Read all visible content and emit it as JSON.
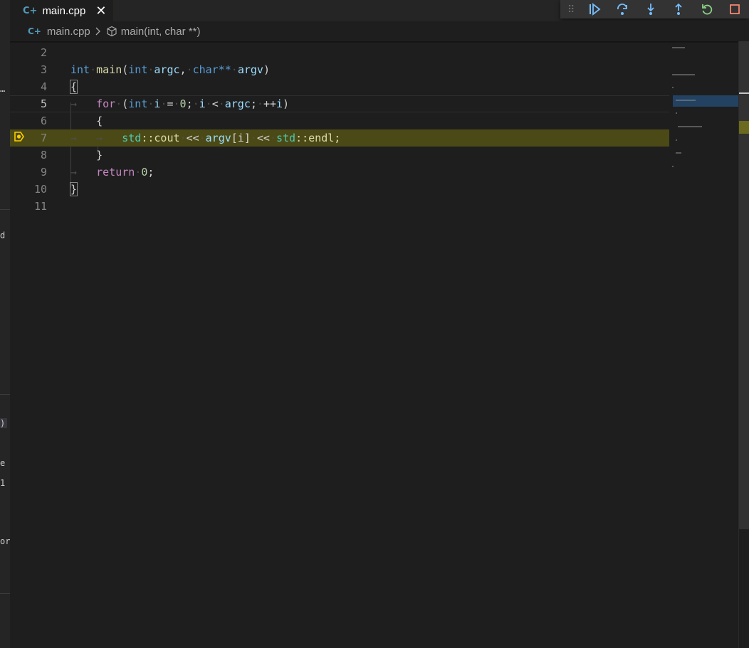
{
  "tab": {
    "label": "main.cpp",
    "close_glyph": "✕",
    "icon": "cpp-file-icon"
  },
  "breadcrumb": {
    "file": "main.cpp",
    "symbol": "main(int, char **)"
  },
  "debug_toolbar": {
    "buttons": [
      {
        "name": "continue-button",
        "icon": "continue-icon"
      },
      {
        "name": "step-over-button",
        "icon": "step-over-icon"
      },
      {
        "name": "step-into-button",
        "icon": "step-into-icon"
      },
      {
        "name": "step-out-button",
        "icon": "step-out-icon"
      },
      {
        "name": "restart-button",
        "icon": "restart-icon"
      },
      {
        "name": "stop-button",
        "icon": "stop-icon"
      }
    ],
    "colors": {
      "step": "#75beff",
      "restart": "#89d185",
      "stop": "#f48771"
    }
  },
  "editor": {
    "current_line": 5,
    "stopped_line": 7,
    "line_numbers": [
      "2",
      "3",
      "4",
      "5",
      "6",
      "7",
      "8",
      "9",
      "10",
      "11"
    ],
    "colors": {
      "keyword": "#569cd6",
      "control": "#c586c0",
      "function": "#dcdcaa",
      "variable": "#9cdcfe",
      "namespace": "#4ec9b0",
      "number": "#b5cea8",
      "stopped_highlight": "#4b4a16",
      "debug_arrow": "#ffcc00"
    },
    "code": {
      "l3": {
        "kw_int": "int",
        "fn_main": "main",
        "p_open": "(",
        "kw_int2": "int",
        "argc": "argc",
        "comma": ",",
        "kw_char": "char**",
        "argv": "argv",
        "p_close": ")"
      },
      "l4": {
        "brace": "{"
      },
      "l5": {
        "kw_for": "for",
        "p_open": "(",
        "kw_int": "int",
        "i": "i",
        "eq": "=",
        "zero": "0",
        "semi1": ";",
        "i2": "i",
        "lt": "<",
        "argc": "argc",
        "semi2": ";",
        "inc": "++",
        "i3": "i",
        "p_close": ")"
      },
      "l6": {
        "brace": "{"
      },
      "l7": {
        "std": "std",
        "cout": "::cout",
        "shl1": "<<",
        "argv": "argv",
        "idx": "[i]",
        "shl2": "<<",
        "std2": "std",
        "endl": "::endl;"
      },
      "l8": {
        "brace": "}"
      },
      "l9": {
        "kw_return": "return",
        "zero": "0",
        "semi": ";"
      },
      "l10": {
        "brace": "}"
      }
    }
  },
  "side_panel_fragments": [
    "…",
    "d",
    ")",
    "e",
    "1",
    "or"
  ]
}
